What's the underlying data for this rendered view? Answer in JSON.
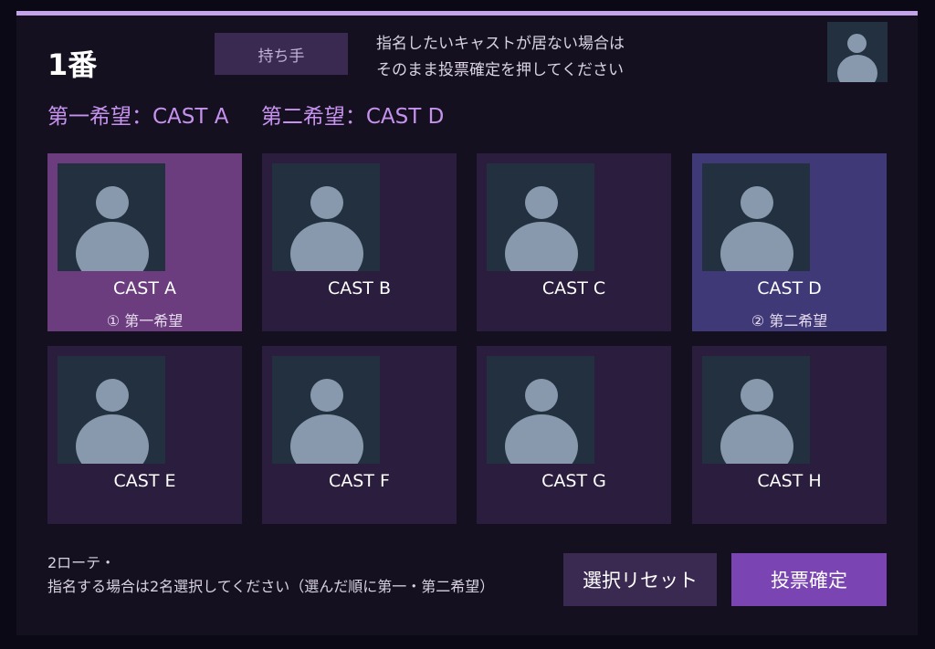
{
  "header": {
    "round_title": "1番",
    "holder_button": "持ち手",
    "notice_line1": "指名したいキャストが居ない場合は",
    "notice_line2": "そのまま投票確定を押してください"
  },
  "selection": {
    "first": "第一希望：CAST A",
    "second": "第二希望：CAST D"
  },
  "casts": [
    {
      "name": "CAST A",
      "badge": "① 第一希望",
      "state": "first"
    },
    {
      "name": "CAST B",
      "badge": "",
      "state": "none"
    },
    {
      "name": "CAST C",
      "badge": "",
      "state": "none"
    },
    {
      "name": "CAST D",
      "badge": "② 第二希望",
      "state": "second"
    },
    {
      "name": "CAST E",
      "badge": "",
      "state": "none"
    },
    {
      "name": "CAST F",
      "badge": "",
      "state": "none"
    },
    {
      "name": "CAST G",
      "badge": "",
      "state": "none"
    },
    {
      "name": "CAST H",
      "badge": "",
      "state": "none"
    }
  ],
  "footer": {
    "note_line1": "2ローテ・",
    "note_line2": "指名する場合は2名選択してください（選んだ順に第一・第二希望）",
    "reset_button": "選択リセット",
    "confirm_button": "投票確定"
  },
  "colors": {
    "accent": "#c5a3ea",
    "first_choice": "#6b3d7e",
    "second_choice": "#3f3a77",
    "confirm": "#7a45b2"
  },
  "icons": {
    "avatar": "person-silhouette-icon"
  }
}
